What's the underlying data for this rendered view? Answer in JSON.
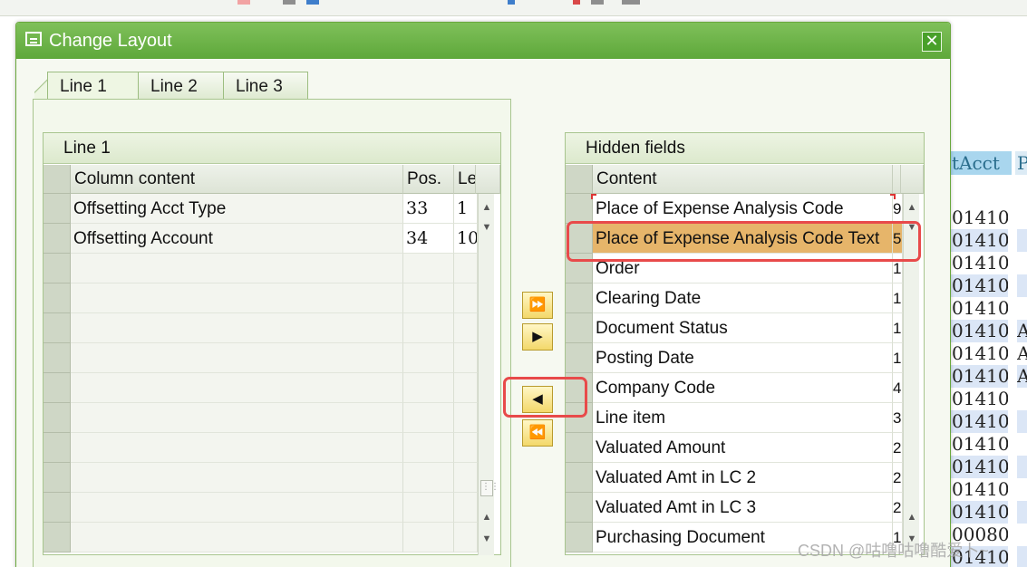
{
  "dialog": {
    "title": "Change Layout",
    "close_label": "✕",
    "tabs": [
      {
        "label": "Line 1",
        "active": true
      },
      {
        "label": "Line 2",
        "active": false
      },
      {
        "label": "Line 3",
        "active": false
      }
    ]
  },
  "left_grid": {
    "title": "Line 1",
    "headers": {
      "content": "Column content",
      "pos": "Pos.",
      "len": "Le"
    },
    "rows": [
      {
        "content": "Offsetting Acct Type",
        "pos": "33",
        "len": "1"
      },
      {
        "content": "Offsetting Account",
        "pos": "34",
        "len": "10"
      }
    ]
  },
  "right_grid": {
    "title": "Hidden fields",
    "headers": {
      "content": "Content"
    },
    "rows": [
      {
        "content": "Place of Expense Analysis Code",
        "len": "9"
      },
      {
        "content": "Place of Expense Analysis Code Text",
        "len": "5",
        "selected": true
      },
      {
        "content": "Order",
        "len": "1"
      },
      {
        "content": "Clearing Date",
        "len": "1"
      },
      {
        "content": "Document Status",
        "len": "1"
      },
      {
        "content": "Posting Date",
        "len": "1"
      },
      {
        "content": "Company Code",
        "len": "4"
      },
      {
        "content": "Line item",
        "len": "3"
      },
      {
        "content": "Valuated Amount",
        "len": "2"
      },
      {
        "content": "Valuated Amt in LC 2",
        "len": "2"
      },
      {
        "content": "Valuated Amt in LC 3",
        "len": "2"
      },
      {
        "content": "Purchasing Document",
        "len": "1"
      }
    ]
  },
  "transfer_buttons": {
    "add_all": "⏩",
    "add_one": "▶",
    "remove_one": "◀",
    "remove_all": "⏪"
  },
  "background_list": {
    "header": [
      "tAcct",
      "P"
    ],
    "rows": [
      {
        "v": "01410",
        "alt": false,
        "c2": ""
      },
      {
        "v": "01410",
        "alt": true,
        "c2": ""
      },
      {
        "v": "01410",
        "alt": false,
        "c2": ""
      },
      {
        "v": "01410",
        "alt": true,
        "c2": ""
      },
      {
        "v": "01410",
        "alt": false,
        "c2": ""
      },
      {
        "v": "01410",
        "alt": true,
        "c2": "A"
      },
      {
        "v": "01410",
        "alt": false,
        "c2": "A"
      },
      {
        "v": "01410",
        "alt": true,
        "c2": "A"
      },
      {
        "v": "01410",
        "alt": false,
        "c2": ""
      },
      {
        "v": "01410",
        "alt": true,
        "c2": ""
      },
      {
        "v": "01410",
        "alt": false,
        "c2": ""
      },
      {
        "v": "01410",
        "alt": true,
        "c2": ""
      },
      {
        "v": "01410",
        "alt": false,
        "c2": ""
      },
      {
        "v": "01410",
        "alt": true,
        "c2": ""
      },
      {
        "v": "00080",
        "alt": false,
        "c2": ""
      },
      {
        "v": "01410",
        "alt": true,
        "c2": ""
      }
    ]
  },
  "watermark": "CSDN @咕噜咕噜酷爱卜~",
  "colors": {
    "accent": "#5ea83a",
    "selection": "#e6b56a",
    "annotation": "#e84a4a"
  }
}
